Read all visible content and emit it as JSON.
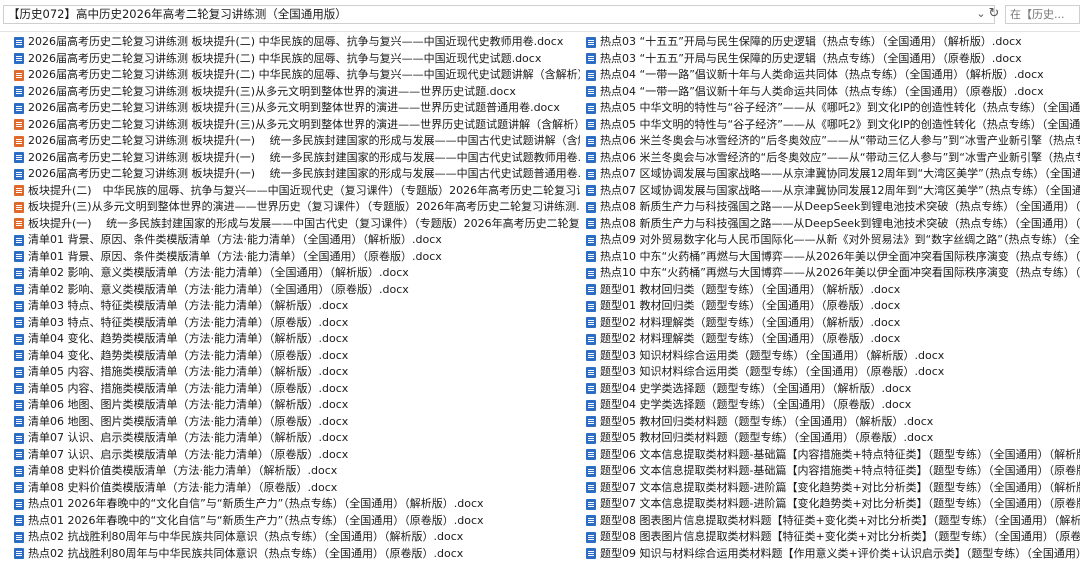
{
  "window": {
    "address": "【历史072】高中历史2026年高考二轮复习讲练测（全国通用版）",
    "search_placeholder": "在【历史..."
  },
  "icons": {
    "dropdown": "chevron-down-icon",
    "refresh": "refresh-icon",
    "docx": "word-doc-icon",
    "pptx": "powerpoint-icon"
  },
  "colors": {
    "docx": "#2b6cc4",
    "pptx": "#e06a2c"
  },
  "files_left": [
    {
      "type": "docx",
      "name": "2026届高考历史二轮复习讲练测 板块提升(二) 中华民族的屈辱、抗争与复兴——中国近现代史教师用卷.docx"
    },
    {
      "type": "docx",
      "name": "2026届高考历史二轮复习讲练测 板块提升(二) 中华民族的屈辱、抗争与复兴——中国近现代史试题.docx"
    },
    {
      "type": "pptx",
      "name": "2026届高考历史二轮复习讲练测 板块提升(二) 中华民族的屈辱、抗争与复兴——中国近现代史试题讲解（含解析）.pptx"
    },
    {
      "type": "docx",
      "name": "2026届高考历史二轮复习讲练测 板块提升(三)从多元文明到整体世界的演进——世界历史试题.docx"
    },
    {
      "type": "docx",
      "name": "2026届高考历史二轮复习讲练测 板块提升(三)从多元文明到整体世界的演进——世界历史试题普通用卷.docx"
    },
    {
      "type": "pptx",
      "name": "2026届高考历史二轮复习讲练测 板块提升(三)从多元文明到整体世界的演进——世界历史试题试题讲解（含解析）.pptx"
    },
    {
      "type": "pptx",
      "name": "2026届高考历史二轮复习讲练测 板块提升(一)　 统一多民族封建国家的形成与发展——中国古代史试题讲解（含解析）.pptx"
    },
    {
      "type": "docx",
      "name": "2026届高考历史二轮复习讲练测 板块提升(一)　 统一多民族封建国家的形成与发展——中国古代史试题教师用卷.docx"
    },
    {
      "type": "docx",
      "name": "2026届高考历史二轮复习讲练测 板块提升(一)　 统一多民族封建国家的形成与发展——中国古代史试题普通用卷.docx"
    },
    {
      "type": "pptx",
      "name": "板块提升(二)　中华民族的屈辱、抗争与复兴——中国近现代史（复习课件）（专题版）2026年高考历史二轮复习讲练测.pptx"
    },
    {
      "type": "pptx",
      "name": "板块提升(三)从多元文明到整体世界的演进——世界历史（复习课件）（专题版）2026年高考历史二轮复习讲练测.pptx"
    },
    {
      "type": "pptx",
      "name": "板块提升(一)　 统一多民族封建国家的形成与发展——中国古代史（复习课件）（专题版）2026年高考历史二轮复习讲练测.pptx"
    },
    {
      "type": "docx",
      "name": "清单01 背景、原因、条件类模版清单（方法·能力清单）（全国通用）（解析版）.docx"
    },
    {
      "type": "docx",
      "name": "清单01 背景、原因、条件类模版清单（方法·能力清单）（全国通用）（原卷版）.docx"
    },
    {
      "type": "docx",
      "name": "清单02 影响、意义类模版清单（方法·能力清单）（全国通用）（解析版）.docx"
    },
    {
      "type": "docx",
      "name": "清单02 影响、意义类模版清单（方法·能力清单）（全国通用）（原卷版）.docx"
    },
    {
      "type": "docx",
      "name": "清单03 特点、特征类模版清单（方法·能力清单）（解析版）.docx"
    },
    {
      "type": "docx",
      "name": "清单03 特点、特征类模版清单（方法·能力清单）（原卷版）.docx"
    },
    {
      "type": "docx",
      "name": "清单04 变化、趋势类模版清单（方法·能力清单）（解析版）.docx"
    },
    {
      "type": "docx",
      "name": "清单04 变化、趋势类模版清单（方法·能力清单）（原卷版）.docx"
    },
    {
      "type": "docx",
      "name": "清单05 内容、措施类模版清单（方法·能力清单）（解析版）.docx"
    },
    {
      "type": "docx",
      "name": "清单05 内容、措施类模版清单（方法·能力清单）（原卷版）.docx"
    },
    {
      "type": "docx",
      "name": "清单06 地图、图片类模版清单（方法·能力清单）（解析版）.docx"
    },
    {
      "type": "docx",
      "name": "清单06 地图、图片类模版清单（方法·能力清单）（原卷版）.docx"
    },
    {
      "type": "docx",
      "name": "清单07 认识、启示类模版清单（方法·能力清单）（解析版）.docx"
    },
    {
      "type": "docx",
      "name": "清单07 认识、启示类模版清单（方法·能力清单）（原卷版）.docx"
    },
    {
      "type": "docx",
      "name": "清单08 史料价值类模版清单（方法·能力清单）（解析版）.docx"
    },
    {
      "type": "docx",
      "name": "清单08 史料价值类模版清单（方法·能力清单）（原卷版）.docx"
    },
    {
      "type": "docx",
      "name": "热点01 2026年春晚中的“文化自信”与“新质生产力”（热点专练）（全国通用）（解析版）.docx"
    },
    {
      "type": "docx",
      "name": "热点01 2026年春晚中的“文化自信”与“新质生产力”（热点专练）（全国通用）（原卷版）.docx"
    },
    {
      "type": "docx",
      "name": "热点02 抗战胜利80周年与中华民族共同体意识（热点专练）（全国通用）（解析版）.docx"
    },
    {
      "type": "docx",
      "name": "热点02 抗战胜利80周年与中华民族共同体意识（热点专练）（全国通用）（原卷版）.docx"
    }
  ],
  "files_right": [
    {
      "type": "docx",
      "name": "热点03 “十五五”开局与民生保障的历史逻辑（热点专练）（全国通用）（解析版）.docx"
    },
    {
      "type": "docx",
      "name": "热点03 “十五五”开局与民生保障的历史逻辑（热点专练）（全国通用）（原卷版）.docx"
    },
    {
      "type": "docx",
      "name": "热点04 “一带一路”倡议新十年与人类命运共同体（热点专练）（全国通用）（解析版）.docx"
    },
    {
      "type": "docx",
      "name": "热点04 “一带一路”倡议新十年与人类命运共同体（热点专练）（全国通用）（原卷版）.docx"
    },
    {
      "type": "docx",
      "name": "热点05 中华文明的特性与“谷子经济”——从《哪吒2》到文化IP的创造性转化（热点专练）（全国通用）（解析版）"
    },
    {
      "type": "docx",
      "name": "热点05 中华文明的特性与“谷子经济”——从《哪吒2》到文化IP的创造性转化（热点专练）（全国通用）（原卷版）"
    },
    {
      "type": "docx",
      "name": "热点06 米兰冬奥会与冰雪经济的“后冬奥效应”——从“带动三亿人参与”到“冰雪产业新引擎（热点专练）（全国通用）"
    },
    {
      "type": "docx",
      "name": "热点06 米兰冬奥会与冰雪经济的“后冬奥效应”——从“带动三亿人参与”到“冰雪产业新引擎（热点专练）（全国通用）"
    },
    {
      "type": "docx",
      "name": "热点07 区域协调发展与国家战略——从京津冀协同发展12周年到“大湾区美学”（热点专练）（全国通用）（解析版）"
    },
    {
      "type": "docx",
      "name": "热点07 区域协调发展与国家战略——从京津冀协同发展12周年到“大湾区美学”（热点专练）（全国通用）（原卷版）"
    },
    {
      "type": "docx",
      "name": "热点08 新质生产力与科技强国之路——从DeepSeek到锂电池技术突破（热点专练）（全国通用）（解析版）"
    },
    {
      "type": "docx",
      "name": "热点08 新质生产力与科技强国之路——从DeepSeek到锂电池技术突破（热点专练）（全国通用）（原卷版）"
    },
    {
      "type": "docx",
      "name": "热点09 对外贸易数字化与人民币国际化——从新《对外贸易法》到“数字丝绸之路”（热点专练）（全国通用）2026"
    },
    {
      "type": "docx",
      "name": "热点10 中东“火药桶”再燃与大国博弈——从2026年美以伊全面冲突看国际秩序演变（热点专练）（全国通用）（解"
    },
    {
      "type": "docx",
      "name": "热点10 中东“火药桶”再燃与大国博弈——从2026年美以伊全面冲突看国际秩序演变（热点专练）（全国通用）（原"
    },
    {
      "type": "docx",
      "name": "题型01 教材回归类（题型专练）（全国通用）（解析版）.docx"
    },
    {
      "type": "docx",
      "name": "题型01 教材回归类（题型专练）（全国通用）（原卷版）.docx"
    },
    {
      "type": "docx",
      "name": "题型02 材料理解类（题型专练）（全国通用）（解析版）.docx"
    },
    {
      "type": "docx",
      "name": "题型02 材料理解类（题型专练）（全国通用）（原卷版）.docx"
    },
    {
      "type": "docx",
      "name": "题型03 知识材料综合运用类（题型专练）（全国通用）（解析版）.docx"
    },
    {
      "type": "docx",
      "name": "题型03 知识材料综合运用类（题型专练）（全国通用）（原卷版）.docx"
    },
    {
      "type": "docx",
      "name": "题型04 史学类选择题（题型专练）（全国通用）（解析版）.docx"
    },
    {
      "type": "docx",
      "name": "题型04 史学类选择题（题型专练）（全国通用）（原卷版）.docx"
    },
    {
      "type": "docx",
      "name": "题型05 教材回归类材料题（题型专练）（全国通用）（解析版）.docx"
    },
    {
      "type": "docx",
      "name": "题型05 教材回归类材料题（题型专练）（全国通用）（原卷版）.docx"
    },
    {
      "type": "docx",
      "name": "题型06 文本信息提取类材料题-基础篇【内容措施类+特点特征类】（题型专练）（全国通用）（解析版）.docx"
    },
    {
      "type": "docx",
      "name": "题型06 文本信息提取类材料题-基础篇【内容措施类+特点特征类】（题型专练）（全国通用）（原卷版）.docx"
    },
    {
      "type": "docx",
      "name": "题型07 文本信息提取类材料题-进阶篇【变化趋势类+对比分析类】（题型专练）（全国通用）（解析版）.docx"
    },
    {
      "type": "docx",
      "name": "题型07 文本信息提取类材料题-进阶篇【变化趋势类+对比分析类】（题型专练）（全国通用）（原卷版）.docx"
    },
    {
      "type": "docx",
      "name": "题型08 图表图片信息提取类材料题【特征类+变化类+对比分析类】（题型专练）（全国通用）（解析版）.docx"
    },
    {
      "type": "docx",
      "name": "题型08 图表图片信息提取类材料题【特征类+变化类+对比分析类】（题型专练）（全国通用）（原卷版）.docx"
    },
    {
      "type": "docx",
      "name": "题型09 知识与材料综合运用类材料题【作用意义类+评价类+认识启示类】（题型专练）（全国通用）（解析版）.doc"
    }
  ]
}
